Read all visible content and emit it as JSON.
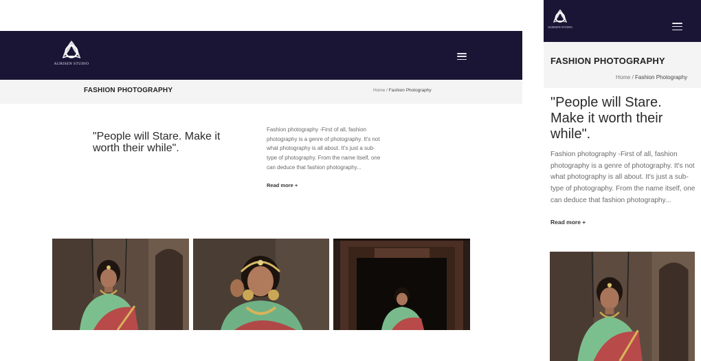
{
  "brand": {
    "logo_text": "AURISEN STUDIO"
  },
  "page": {
    "title": "FASHION PHOTOGRAPHY"
  },
  "breadcrumb": {
    "home": "Home",
    "separator": "/",
    "current": "Fashion Photography"
  },
  "intro": {
    "quote": "\"People will Stare. Make it worth their while\".",
    "excerpt": "Fashion photography -First of all, fashion photography is a genre of photography. It's not what photography is all about. It's just a sub-type of photography. From the name itself, one can deduce that fashion photography...",
    "read_more": "Read more +"
  },
  "gallery": {
    "count": 3
  },
  "colors": {
    "header_bg": "#1a1535",
    "titlebar_bg": "#f4f4f4",
    "text_dark": "#222222",
    "text_muted": "#6a6a6a"
  },
  "icons": {
    "menu": "hamburger-icon",
    "logo": "logo-mark"
  }
}
